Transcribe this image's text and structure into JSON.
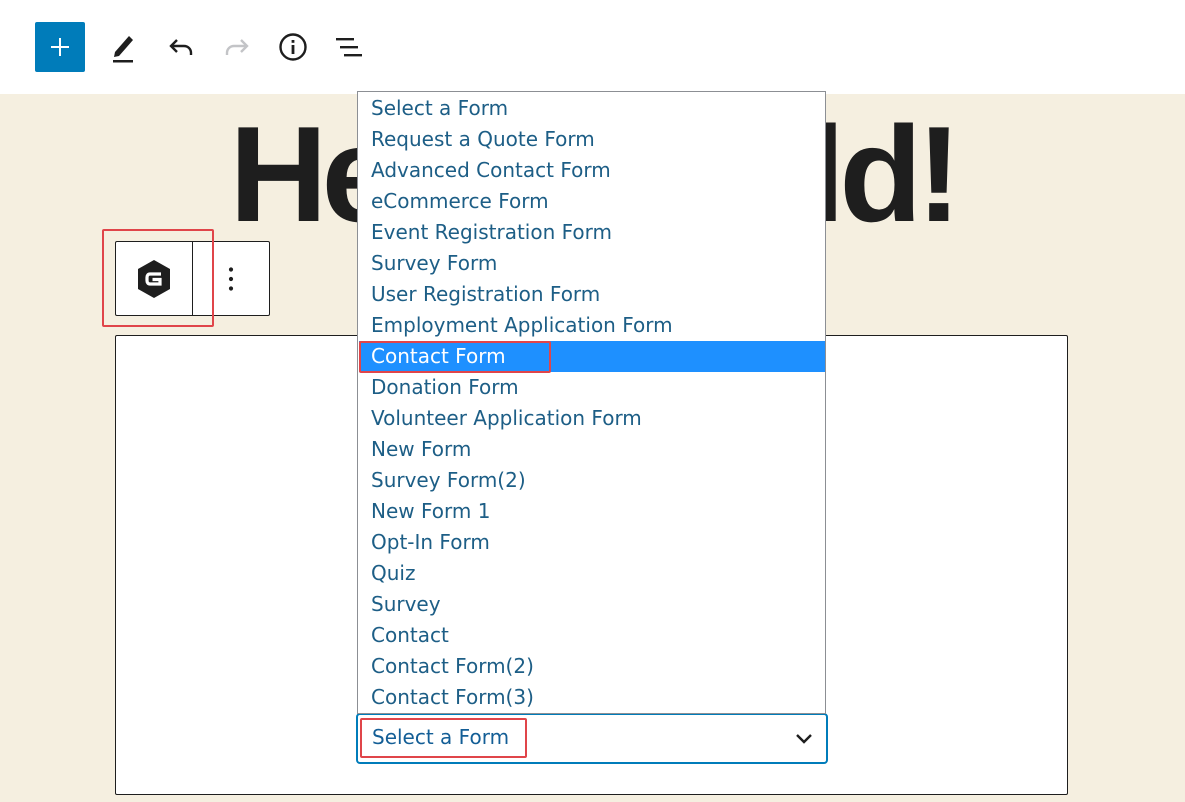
{
  "toolbar": {
    "add_icon": "plus-icon",
    "tools_icon": "pencil-icon",
    "undo_icon": "undo-icon",
    "redo_icon": "redo-icon",
    "details_icon": "info-icon",
    "list_view_icon": "list-view-icon"
  },
  "heading": {
    "text": "Hello World!"
  },
  "block_toolbar": {
    "block_icon": "gravity-forms-icon",
    "more_icon": "more-vertical-icon"
  },
  "form_select": {
    "selected_value": "Select a Form",
    "chevron_icon": "chevron-down-icon"
  },
  "dropdown": {
    "options": [
      "Select a Form",
      "Request a Quote Form",
      "Advanced Contact Form",
      "eCommerce Form",
      "Event Registration Form",
      "Survey Form",
      "User Registration Form",
      "Employment Application Form",
      "Contact Form",
      "Donation Form",
      "Volunteer Application Form",
      "New Form",
      "Survey Form(2)",
      "New Form 1",
      "Opt-In Form",
      "Quiz",
      "Survey",
      "Contact",
      "Contact Form(2)",
      "Contact Form(3)"
    ],
    "highlighted": "Contact Form"
  },
  "colors": {
    "accent": "#007cba",
    "highlight_bg": "#1e90ff",
    "canvas_bg": "#f5efe0",
    "annotation_red": "#e0454a",
    "option_text": "#1d5e86"
  }
}
